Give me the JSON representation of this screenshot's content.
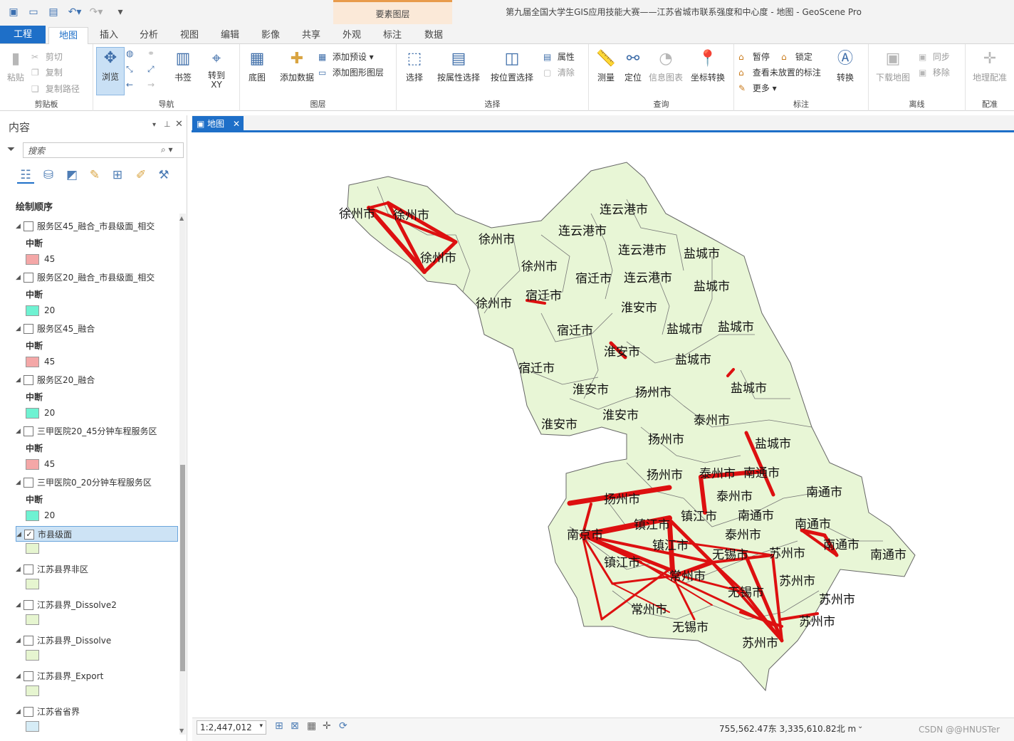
{
  "window": {
    "title": "第九届全国大学生GIS应用技能大赛——江苏省城市联系强度和中心度 - 地图 - GeoScene Pro",
    "context_group": "要素图层"
  },
  "tabs": [
    "工程",
    "地图",
    "插入",
    "分析",
    "视图",
    "编辑",
    "影像",
    "共享",
    "外观",
    "标注",
    "数据"
  ],
  "ribbon": {
    "clipboard": {
      "label": "剪贴板",
      "paste": "粘贴",
      "cut": "剪切",
      "copy": "复制",
      "copy_path": "复制路径"
    },
    "navigate": {
      "label": "导航",
      "explore": "浏览",
      "bookmark": "书签",
      "goto_xy": "转到\nXY"
    },
    "layer": {
      "label": "图层",
      "basemap": "底图",
      "add_data": "添加数据",
      "add_preset": "添加预设",
      "add_graphics": "添加图形图层"
    },
    "selection": {
      "label": "选择",
      "select": "选择",
      "by_attr": "按属性选择",
      "by_loc": "按位置选择",
      "attributes": "属性",
      "clear": "清除"
    },
    "inquiry": {
      "label": "查询",
      "measure": "测量",
      "locate": "定位",
      "infographics": "信息图表",
      "coord_conv": "坐标转换"
    },
    "labeling": {
      "label": "标注",
      "pause": "暂停",
      "lock": "锁定",
      "view_unplaced": "查看未放置的标注",
      "more": "更多",
      "convert": "转换"
    },
    "offline": {
      "label": "离线",
      "download": "下载地图",
      "sync": "同步",
      "remove": "移除"
    },
    "georef": {
      "label": "配准",
      "georeference": "地理配准"
    }
  },
  "contents": {
    "title": "内容",
    "search_placeholder": "搜索",
    "draw_order": "绘制顺序",
    "layers": [
      {
        "name": "服务区45_融合_市县级面_相交",
        "checked": false,
        "class": "中断",
        "value": "45",
        "color": "#f4a7a7"
      },
      {
        "name": "服务区20_融合_市县级面_相交",
        "checked": false,
        "class": "中断",
        "value": "20",
        "color": "#6ff2d2"
      },
      {
        "name": "服务区45_融合",
        "checked": false,
        "class": "中断",
        "value": "45",
        "color": "#f4a7a7"
      },
      {
        "name": "服务区20_融合",
        "checked": false,
        "class": "中断",
        "value": "20",
        "color": "#6ff2d2"
      },
      {
        "name": "三甲医院20_45分钟车程服务区",
        "checked": false,
        "class": "中断",
        "value": "45",
        "color": "#f4a7a7"
      },
      {
        "name": "三甲医院0_20分钟车程服务区",
        "checked": false,
        "class": "中断",
        "value": "20",
        "color": "#6ff2d2"
      },
      {
        "name": "市县级面",
        "checked": true,
        "color": "#e6f5d0"
      },
      {
        "name": "江苏县界非区",
        "checked": false,
        "color": "#e6f5d0"
      },
      {
        "name": "江苏县界_Dissolve2",
        "checked": false,
        "color": "#e6f5d0"
      },
      {
        "name": "江苏县界_Dissolve",
        "checked": false,
        "color": "#e6f5d0"
      },
      {
        "name": "江苏县界_Export",
        "checked": false,
        "color": "#e6f5d0"
      },
      {
        "name": "江苏省省界",
        "checked": false,
        "color": "#d6ecf6"
      }
    ]
  },
  "map": {
    "tab": "地图",
    "labels": [
      "徐州市",
      "徐州市",
      "徐州市",
      "徐州市",
      "徐州市",
      "徐州市",
      "连云港市",
      "连云港市",
      "连云港市",
      "连云港市",
      "宿迁市",
      "宿迁市",
      "宿迁市",
      "宿迁市",
      "盐城市",
      "盐城市",
      "盐城市",
      "盐城市",
      "盐城市",
      "盐城市",
      "盐城市",
      "淮安市",
      "淮安市",
      "淮安市",
      "淮安市",
      "淮安市",
      "扬州市",
      "扬州市",
      "扬州市",
      "扬州市",
      "泰州市",
      "泰州市",
      "泰州市",
      "泰州市",
      "南通市",
      "南通市",
      "南通市",
      "南通市",
      "南通市",
      "南通市",
      "南京市",
      "镇江市",
      "镇江市",
      "镇江市",
      "镇江市",
      "常州市",
      "常州市",
      "无锡市",
      "无锡市",
      "无锡市",
      "苏州市",
      "苏州市",
      "苏州市",
      "苏州市",
      "苏州市"
    ]
  },
  "status": {
    "scale": "1:2,447,012",
    "coords": "755,562.47东 3,335,610.82北 m",
    "watermark": "CSDN @@HNUSTer"
  }
}
